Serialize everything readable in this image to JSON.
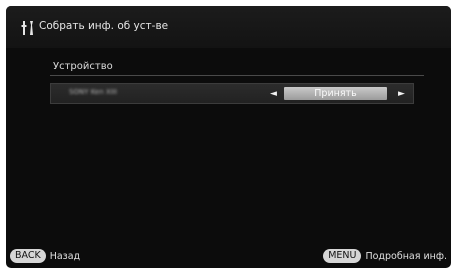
{
  "header": {
    "icon": "tools-icon",
    "title": "Собрать инф. об уст-ве"
  },
  "section": {
    "label": "Устройство"
  },
  "device_row": {
    "name": "SONY Ken XIII",
    "left_arrow": "◄",
    "accept_label": "Принять",
    "right_arrow": "►"
  },
  "footer": {
    "back_key": "BACK",
    "back_label": "Назад",
    "menu_key": "MENU",
    "menu_label": "Подробная инф."
  }
}
